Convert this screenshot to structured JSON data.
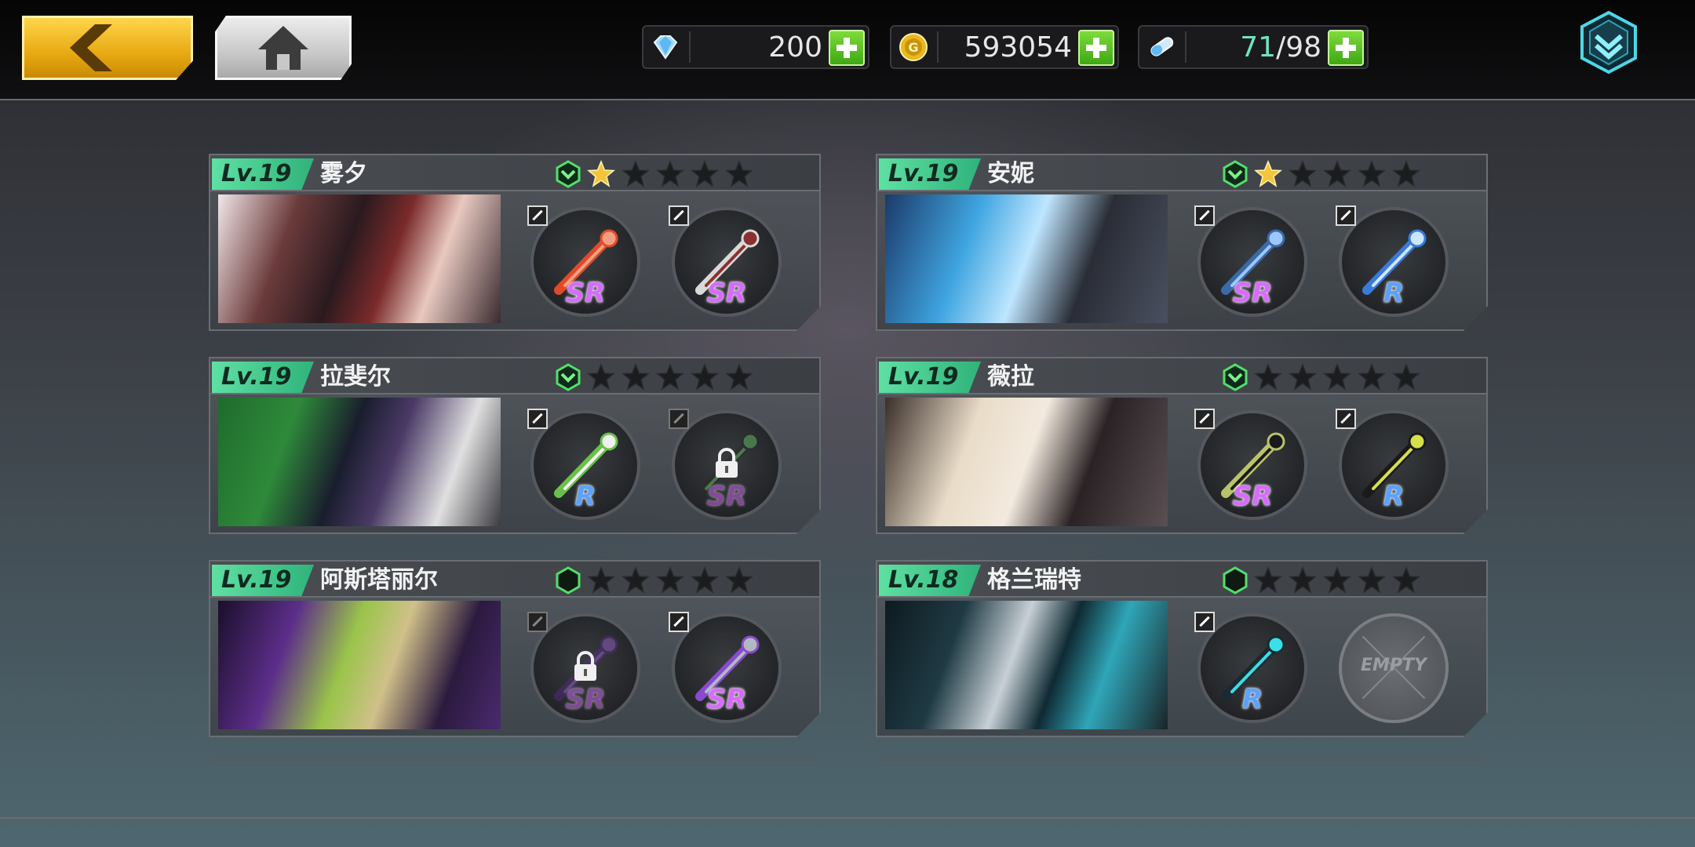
{
  "resources": {
    "diamonds": "200",
    "gold": "593054",
    "stamina_current": "71",
    "stamina_max": "/98"
  },
  "colors": {
    "level_tag": "#3fc08a",
    "sr": "#d86bff",
    "r": "#5aa2ff",
    "star_gold": "#f6c43a",
    "plus_green": "#4fbf1f"
  },
  "characters": [
    {
      "level": "Lv.19",
      "name": "雾夕",
      "stars": 1,
      "rank_icon": "chevron-hex-icon",
      "slot1": {
        "rarity": "SR",
        "locked": false,
        "icon": "red-fan-icon"
      },
      "slot2": {
        "rarity": "SR",
        "locked": false,
        "icon": "braided-whip-icon"
      }
    },
    {
      "level": "Lv.19",
      "name": "安妮",
      "stars": 1,
      "rank_icon": "chevron-hex-icon",
      "slot1": {
        "rarity": "SR",
        "locked": false,
        "icon": "bear-cannon-icon"
      },
      "slot2": {
        "rarity": "R",
        "locked": false,
        "icon": "blue-wand-icon"
      }
    },
    {
      "level": "Lv.19",
      "name": "拉斐尔",
      "stars": 0,
      "rank_icon": "chevron-hex-icon",
      "slot1": {
        "rarity": "R",
        "locked": false,
        "icon": "flower-staff-icon"
      },
      "slot2": {
        "rarity": "SR",
        "locked": true,
        "icon": "chain-icon"
      }
    },
    {
      "level": "Lv.19",
      "name": "薇拉",
      "stars": 0,
      "rank_icon": "chevron-hex-icon",
      "slot1": {
        "rarity": "SR",
        "locked": false,
        "icon": "death-can-icon"
      },
      "slot2": {
        "rarity": "R",
        "locked": false,
        "icon": "hair-dryer-icon"
      }
    },
    {
      "level": "Lv.19",
      "name": "阿斯塔丽尔",
      "stars": 0,
      "rank_icon": "hexagon-icon",
      "slot1": {
        "rarity": "SR",
        "locked": true,
        "icon": "dark-bow-icon"
      },
      "slot2": {
        "rarity": "SR",
        "locked": false,
        "icon": "twin-blades-icon"
      }
    },
    {
      "level": "Lv.18",
      "name": "格兰瑞特",
      "stars": 0,
      "rank_icon": "hexagon-icon",
      "slot1": {
        "rarity": "R",
        "locked": false,
        "icon": "cyan-scythe-icon"
      },
      "slot2": {
        "rarity": "",
        "locked": false,
        "empty": true,
        "empty_label": "EMPTY"
      }
    }
  ]
}
